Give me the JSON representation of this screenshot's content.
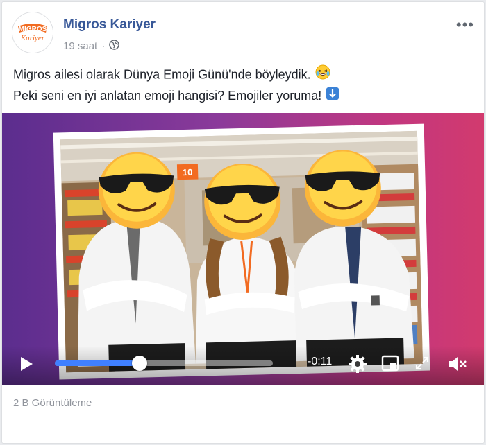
{
  "post": {
    "page_name": "Migros Kariyer",
    "time": "19 saat",
    "separator": "·",
    "more_label": "•••",
    "logo": {
      "line1": "MIGROS",
      "line2": "Kariyer"
    },
    "caption_line1": "Migros ailesi olarak Dünya Emoji Günü'nde böyleydik.",
    "caption_line2": "Peki seni en iyi anlatan emoji hangisi? Emojiler yoruma!"
  },
  "video": {
    "progress": 0.39,
    "time_remaining": "-0:11",
    "shelf_sign": "10",
    "gradient_colors": [
      "#5b2d8e",
      "#8b3a9a",
      "#c2377f",
      "#d23a6e"
    ],
    "progress_color": "#4080ff"
  },
  "footer": {
    "views": "2 B Görüntüleme"
  },
  "colors": {
    "link": "#385898",
    "meta": "#90949c",
    "text": "#1d2129"
  }
}
